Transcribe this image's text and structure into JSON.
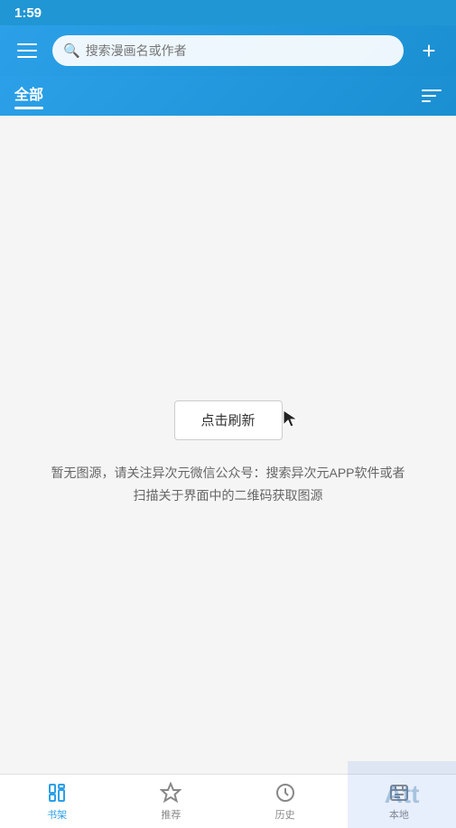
{
  "statusBar": {
    "time": "1:59"
  },
  "header": {
    "searchPlaceholder": "搜索漫画名或作者",
    "addLabel": "+"
  },
  "categoryBar": {
    "activeCategory": "全部"
  },
  "mainContent": {
    "refreshButtonLabel": "点击刷新",
    "infoText": "暂无图源，请关注异次元微信公众号：搜索异次元APP软件或者扫描关于界面中的二维码获取图源"
  },
  "bottomNav": {
    "items": [
      {
        "id": "shelf",
        "label": "书架",
        "active": true
      },
      {
        "id": "recommend",
        "label": "推荐",
        "active": false
      },
      {
        "id": "history",
        "label": "历史",
        "active": false
      },
      {
        "id": "local",
        "label": "本地",
        "active": false
      }
    ]
  },
  "watermark": {
    "text": "Att"
  }
}
